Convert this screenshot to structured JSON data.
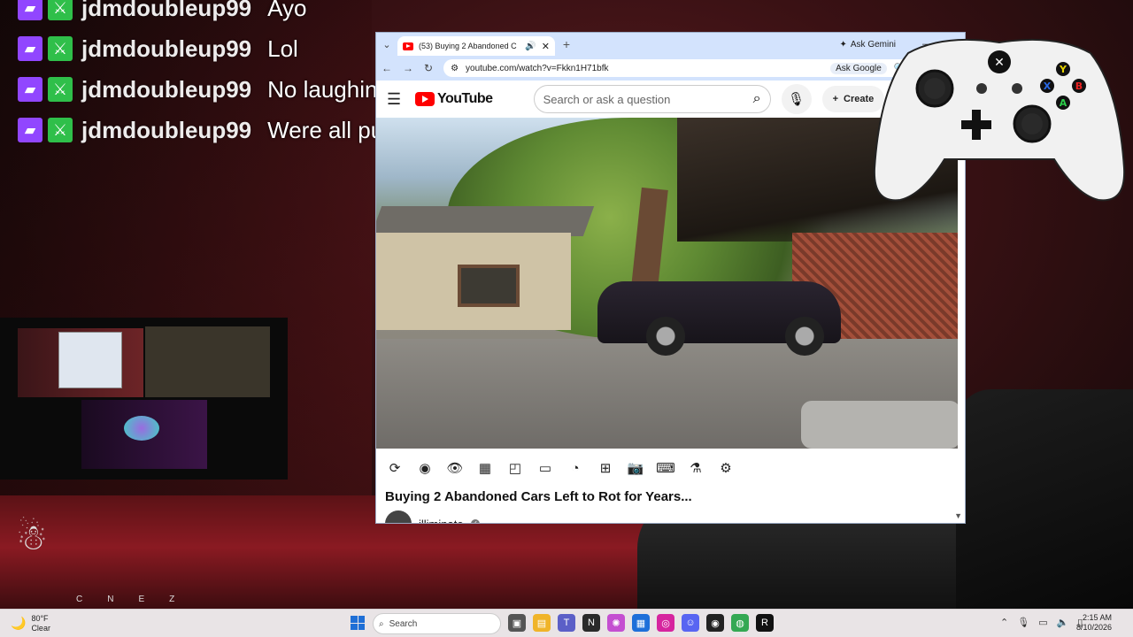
{
  "chat": {
    "messages": [
      {
        "user": "jdmdoubleup99",
        "text": "Ayo"
      },
      {
        "user": "jdmdoubleup99",
        "text": "Lol"
      },
      {
        "user": "jdmdoubleup99",
        "text": "No laughing"
      },
      {
        "user": "jdmdoubleup99",
        "text": "Were all pulling an all nighter"
      }
    ]
  },
  "browser": {
    "tab_title": "(53) Buying 2 Abandoned C",
    "new_tab": "+",
    "gemini": "Ask Gemini",
    "url": "youtube.com/watch?v=Fkkn1H71bfk",
    "ask_google": "Ask Google"
  },
  "youtube": {
    "logo": "YouTube",
    "search_placeholder": "Search or ask a question",
    "create": "Create",
    "video_title": "Buying 2 Abandoned Cars Left to Rot for Years...",
    "channel": "illiminate"
  },
  "overlay": {
    "cnez": "CNEZ"
  },
  "taskbar": {
    "temp": "80°F",
    "weather": "Clear",
    "search": "Search",
    "time": "2:15 AM",
    "date": "8/10/2026"
  },
  "colors": {
    "twitch": "#9146ff",
    "badge_green": "#2fbf4a",
    "youtube_red": "#ff0000",
    "chrome_frame": "#d3e3fd"
  }
}
